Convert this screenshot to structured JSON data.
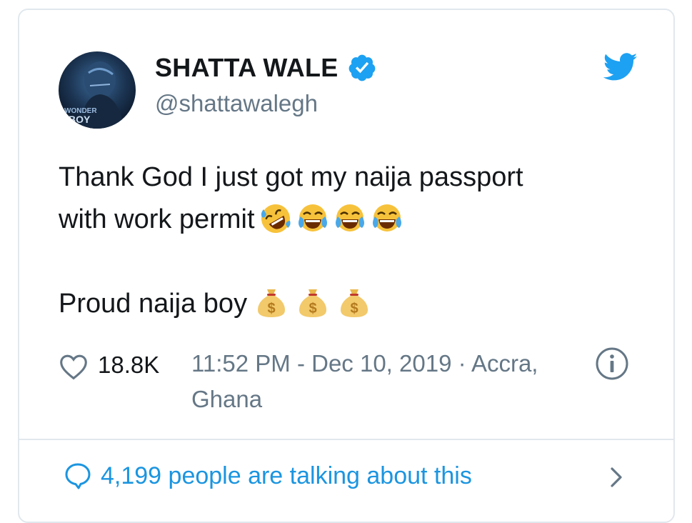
{
  "tweet": {
    "display_name": "SHATTA WALE",
    "handle": "@shattawalegh",
    "avatar_badge_text": "WONDER BOY",
    "text_line_1": "Thank God I just got my naija passport",
    "text_line_2": "with work permit",
    "text_line_2_emojis": [
      "rolling-on-floor-laughing",
      "tears-of-joy",
      "tears-of-joy",
      "tears-of-joy"
    ],
    "text_line_3": "Proud naija boy",
    "text_line_3_emojis": [
      "money-bag",
      "money-bag",
      "money-bag"
    ],
    "likes": "18.8K",
    "timestamp": "11:52 PM - Dec 10, 2019 · Accra, Ghana"
  },
  "footer": {
    "talking_label": "4,199 people are talking about this"
  },
  "icons": {
    "verified": "verified-badge-icon",
    "brand": "twitter-bird-icon",
    "like": "heart-icon",
    "info": "info-icon",
    "comment": "speech-bubble-icon",
    "chevron": "chevron-right-icon"
  },
  "colors": {
    "twitter_blue": "#1da1f2",
    "link_blue": "#1b95e0",
    "text": "#14171a",
    "muted": "#657786",
    "border": "#e1e8ed"
  }
}
